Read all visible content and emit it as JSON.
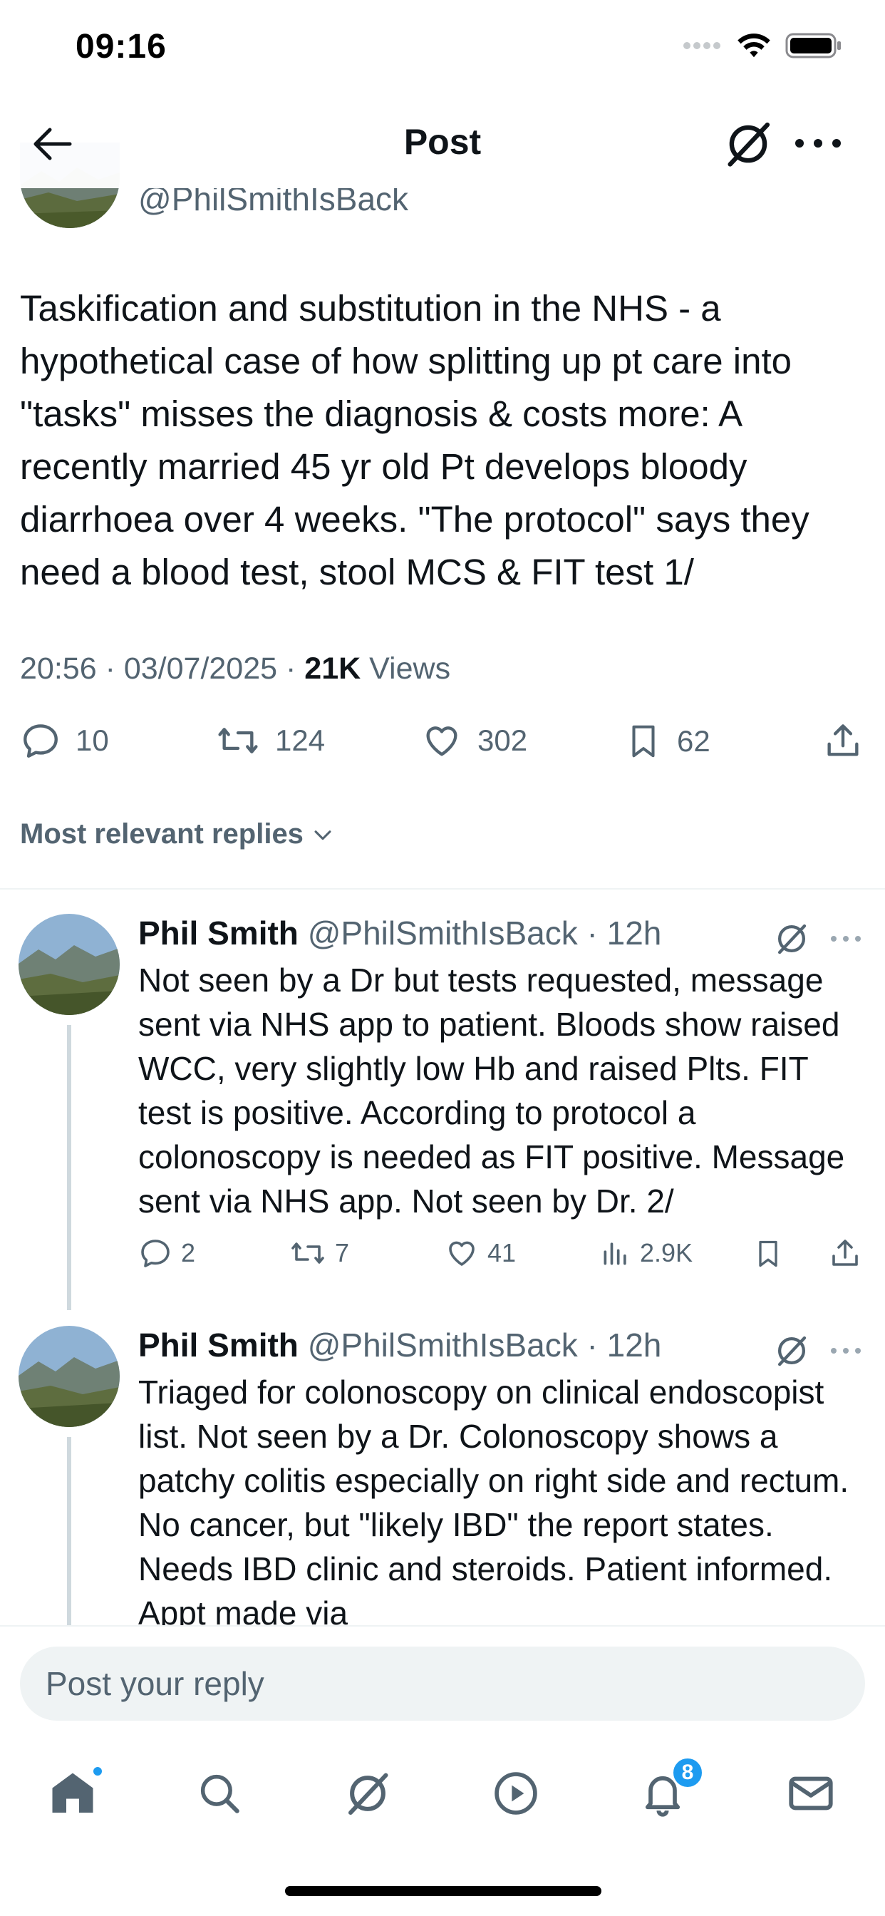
{
  "status_bar": {
    "time": "09:16"
  },
  "header": {
    "title": "Post"
  },
  "post": {
    "handle": "@PhilSmithIsBack",
    "text": "Taskification and substitution in the NHS - a hypothetical case of how splitting up pt care into \"tasks\" misses the diagnosis & costs more: A recently married 45 yr old Pt develops bloody diarrhoea over 4 weeks.  \"The protocol\" says they need a blood test, stool MCS & FIT test 1/",
    "time": "20:56",
    "date": "03/07/2025",
    "views_count": "21K",
    "views_label": "Views",
    "replies": "10",
    "reposts": "124",
    "likes": "302",
    "bookmarks": "62"
  },
  "replies_sort": {
    "label": "Most relevant replies"
  },
  "replies": [
    {
      "name": "Phil Smith",
      "handle": "@PhilSmithIsBack",
      "time": "12h",
      "text": "Not seen by a Dr but tests requested, message sent via NHS app to patient. Bloods show raised WCC, very slightly low Hb and raised Plts. FIT test is positive.  According to protocol a colonoscopy is needed as FIT positive. Message sent via NHS app. Not seen by Dr. 2/",
      "replies": "2",
      "reposts": "7",
      "likes": "41",
      "views": "2.9K"
    },
    {
      "name": "Phil Smith",
      "handle": "@PhilSmithIsBack",
      "time": "12h",
      "text": "Triaged for colonoscopy on clinical endoscopist list. Not seen by a Dr. Colonoscopy shows a patchy colitis especially on right side and rectum. No cancer, but \"likely IBD\" the report states. Needs IBD clinic and steroids. Patient informed. Appt made via"
    }
  ],
  "composer": {
    "placeholder": "Post your reply"
  },
  "tab_bar": {
    "notifications_badge": "8"
  },
  "colors": {
    "accent": "#1d9bf0",
    "secondary_text": "#536471",
    "primary_text": "#0f1419"
  }
}
